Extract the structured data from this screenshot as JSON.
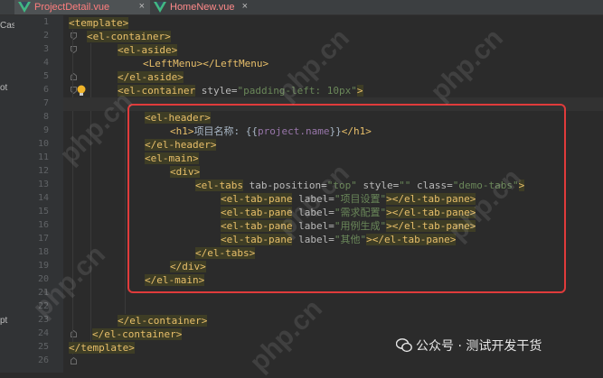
{
  "tabs": [
    {
      "label": "ProjectDetail.vue",
      "active": true
    },
    {
      "label": "HomeNew.vue",
      "active": false
    }
  ],
  "left_panel": {
    "top_text": "Cas",
    "mid_text": "ot",
    "low_text": "pt"
  },
  "line_numbers": [
    "1",
    "2",
    "3",
    "4",
    "5",
    "6",
    "7",
    "8",
    "9",
    "10",
    "11",
    "12",
    "13",
    "14",
    "15",
    "16",
    "17",
    "18",
    "19",
    "20",
    "21",
    "22",
    "23",
    "24",
    "25",
    "26"
  ],
  "code": {
    "l1_open": "<",
    "l1_tag": "template",
    "l1_close": ">",
    "l2_tag": "<el-container>",
    "l3_tag": "<el-aside>",
    "l4_a": "<LeftMenu>",
    "l4_b": "</LeftMenu>",
    "l5_tag": "</el-aside>",
    "l6_tag": "<el-container",
    "l6_attr": " style=",
    "l6_val": "\"padding-left: 10px\"",
    "l6_end": ">",
    "l8_tag": "<el-header>",
    "l9_open": "<h1>",
    "l9_text": "项目名称: {{",
    "l9_interp": "project.name",
    "l9_text2": "}}",
    "l9_close": "</h1>",
    "l10_tag": "</el-header>",
    "l11_tag": "<el-main>",
    "l12_tag": "<div>",
    "l13_tag": "<el-tabs",
    "l13_a1": " tab-position=",
    "l13_v1": "\"top\"",
    "l13_a2": " style=",
    "l13_v2": "\"\"",
    "l13_a3": " class=",
    "l13_v3": "\"demo-tabs\"",
    "l13_end": ">",
    "pane_open": "<el-tab-pane",
    "pane_attr": " label=",
    "pane_close": "></el-tab-pane>",
    "pane_labels": [
      "\"项目设置\"",
      "\"需求配置\"",
      "\"用例生成\"",
      "\"其他\""
    ],
    "l18_tag": "</el-tabs>",
    "l19_tag": "</div>",
    "l20_tag": "</el-main>",
    "l23_tag": "</el-container>",
    "l24_tag": "</el-container>",
    "l25_tag": "</template>"
  },
  "watermark": "php.cn",
  "brand": {
    "text": "公众号 · 测试开发干货"
  },
  "colors": {
    "highlight_box": "#e03b3b",
    "tag": "#e8bf6a",
    "string": "#6a8759",
    "background": "#2b2b2b"
  }
}
